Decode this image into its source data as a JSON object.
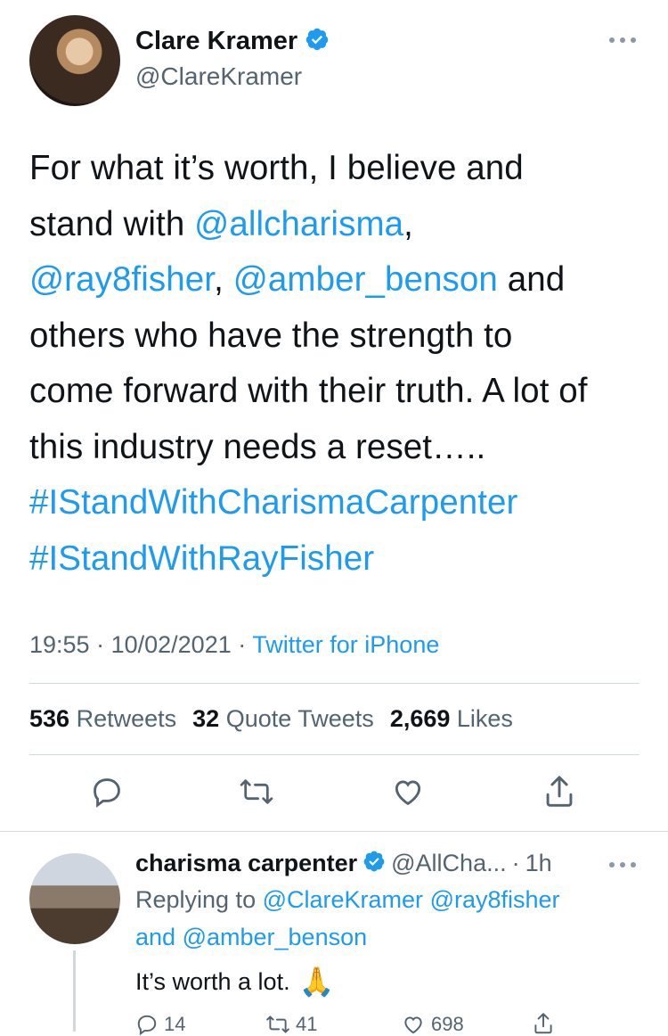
{
  "tweet": {
    "author": {
      "display_name": "Clare Kramer",
      "handle": "@ClareKramer",
      "verified": true
    },
    "text_segments": [
      {
        "text": "For what it’s worth, I believe and",
        "type": "text"
      },
      {
        "text": "stand with ",
        "type": "text"
      },
      {
        "text": "@allcharisma",
        "type": "link"
      },
      {
        "text": ",",
        "type": "text"
      },
      {
        "text": "@ray8fisher",
        "type": "link"
      },
      {
        "text": ", ",
        "type": "text"
      },
      {
        "text": "@amber_benson",
        "type": "link"
      },
      {
        "text": " and",
        "type": "text"
      },
      {
        "text": "others who have the strength to",
        "type": "text"
      },
      {
        "text": "come forward with their truth. A lot of",
        "type": "text"
      },
      {
        "text": "this industry needs a reset…..",
        "type": "text"
      },
      {
        "text": "#IStandWithCharismaCarpenter",
        "type": "link"
      },
      {
        "text": "#IStandWithRayFisher",
        "type": "link"
      }
    ],
    "time": "19:55",
    "date": "10/02/2021",
    "source": "Twitter for iPhone",
    "stats": {
      "retweets_count": "536",
      "retweets_label": "Retweets",
      "quote_count": "32",
      "quote_label": "Quote Tweets",
      "likes_count": "2,669",
      "likes_label": "Likes"
    },
    "actions": [
      "reply-icon",
      "retweet-icon",
      "like-icon",
      "share-icon"
    ],
    "more_icon": "more-icon"
  },
  "reply": {
    "author": {
      "display_name": "charisma carpenter",
      "handle": "@AllCha...",
      "verified": true
    },
    "age": "1h",
    "replying_to_label": "Replying to",
    "replying_to_1": "@ClareKramer",
    "replying_to_2": "@ray8fisher",
    "and_label": "and",
    "replying_to_3": "@amber_benson",
    "text": "It’s worth a lot.",
    "emoji": "🙏",
    "counts": {
      "replies": "14",
      "retweets": "41",
      "likes": "698"
    }
  },
  "colors": {
    "link": "#1d9bf0",
    "muted": "#536471",
    "divider": "#cfd9de"
  }
}
